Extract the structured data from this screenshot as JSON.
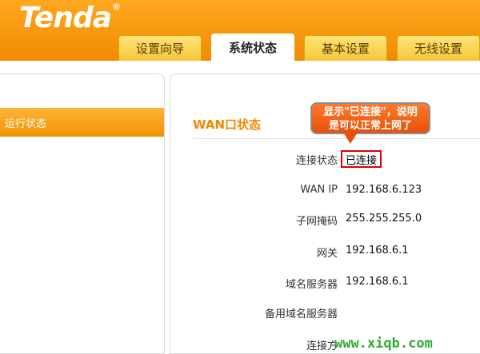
{
  "brand": {
    "logo": "Tenda",
    "reg": "®"
  },
  "tabs": [
    {
      "label": "设置向导",
      "active": false
    },
    {
      "label": "系统状态",
      "active": true
    },
    {
      "label": "基本设置",
      "active": false
    },
    {
      "label": "无线设置",
      "active": false
    }
  ],
  "sidebar": {
    "items": [
      {
        "label": "运行状态",
        "active": true
      }
    ]
  },
  "main": {
    "section_title": "WAN口状态",
    "rows": [
      {
        "label": "连接状态",
        "value": "已连接"
      },
      {
        "label": "WAN IP",
        "value": "192.168.6.123"
      },
      {
        "label": "子网掩码",
        "value": "255.255.255.0"
      },
      {
        "label": "网关",
        "value": "192.168.6.1"
      },
      {
        "label": "域名服务器",
        "value": "192.168.6.1"
      },
      {
        "label": "备用域名服务器",
        "value": ""
      },
      {
        "label": "连接方",
        "value": ""
      }
    ]
  },
  "callout": {
    "line1": "显示\"已连接\"，说明",
    "line2": "是可以正常上网了"
  },
  "watermark": "www.xiqb.com",
  "colors": {
    "brand_orange": "#f39200",
    "highlight_red": "#e00000",
    "callout_orange": "#ff6a1a"
  }
}
